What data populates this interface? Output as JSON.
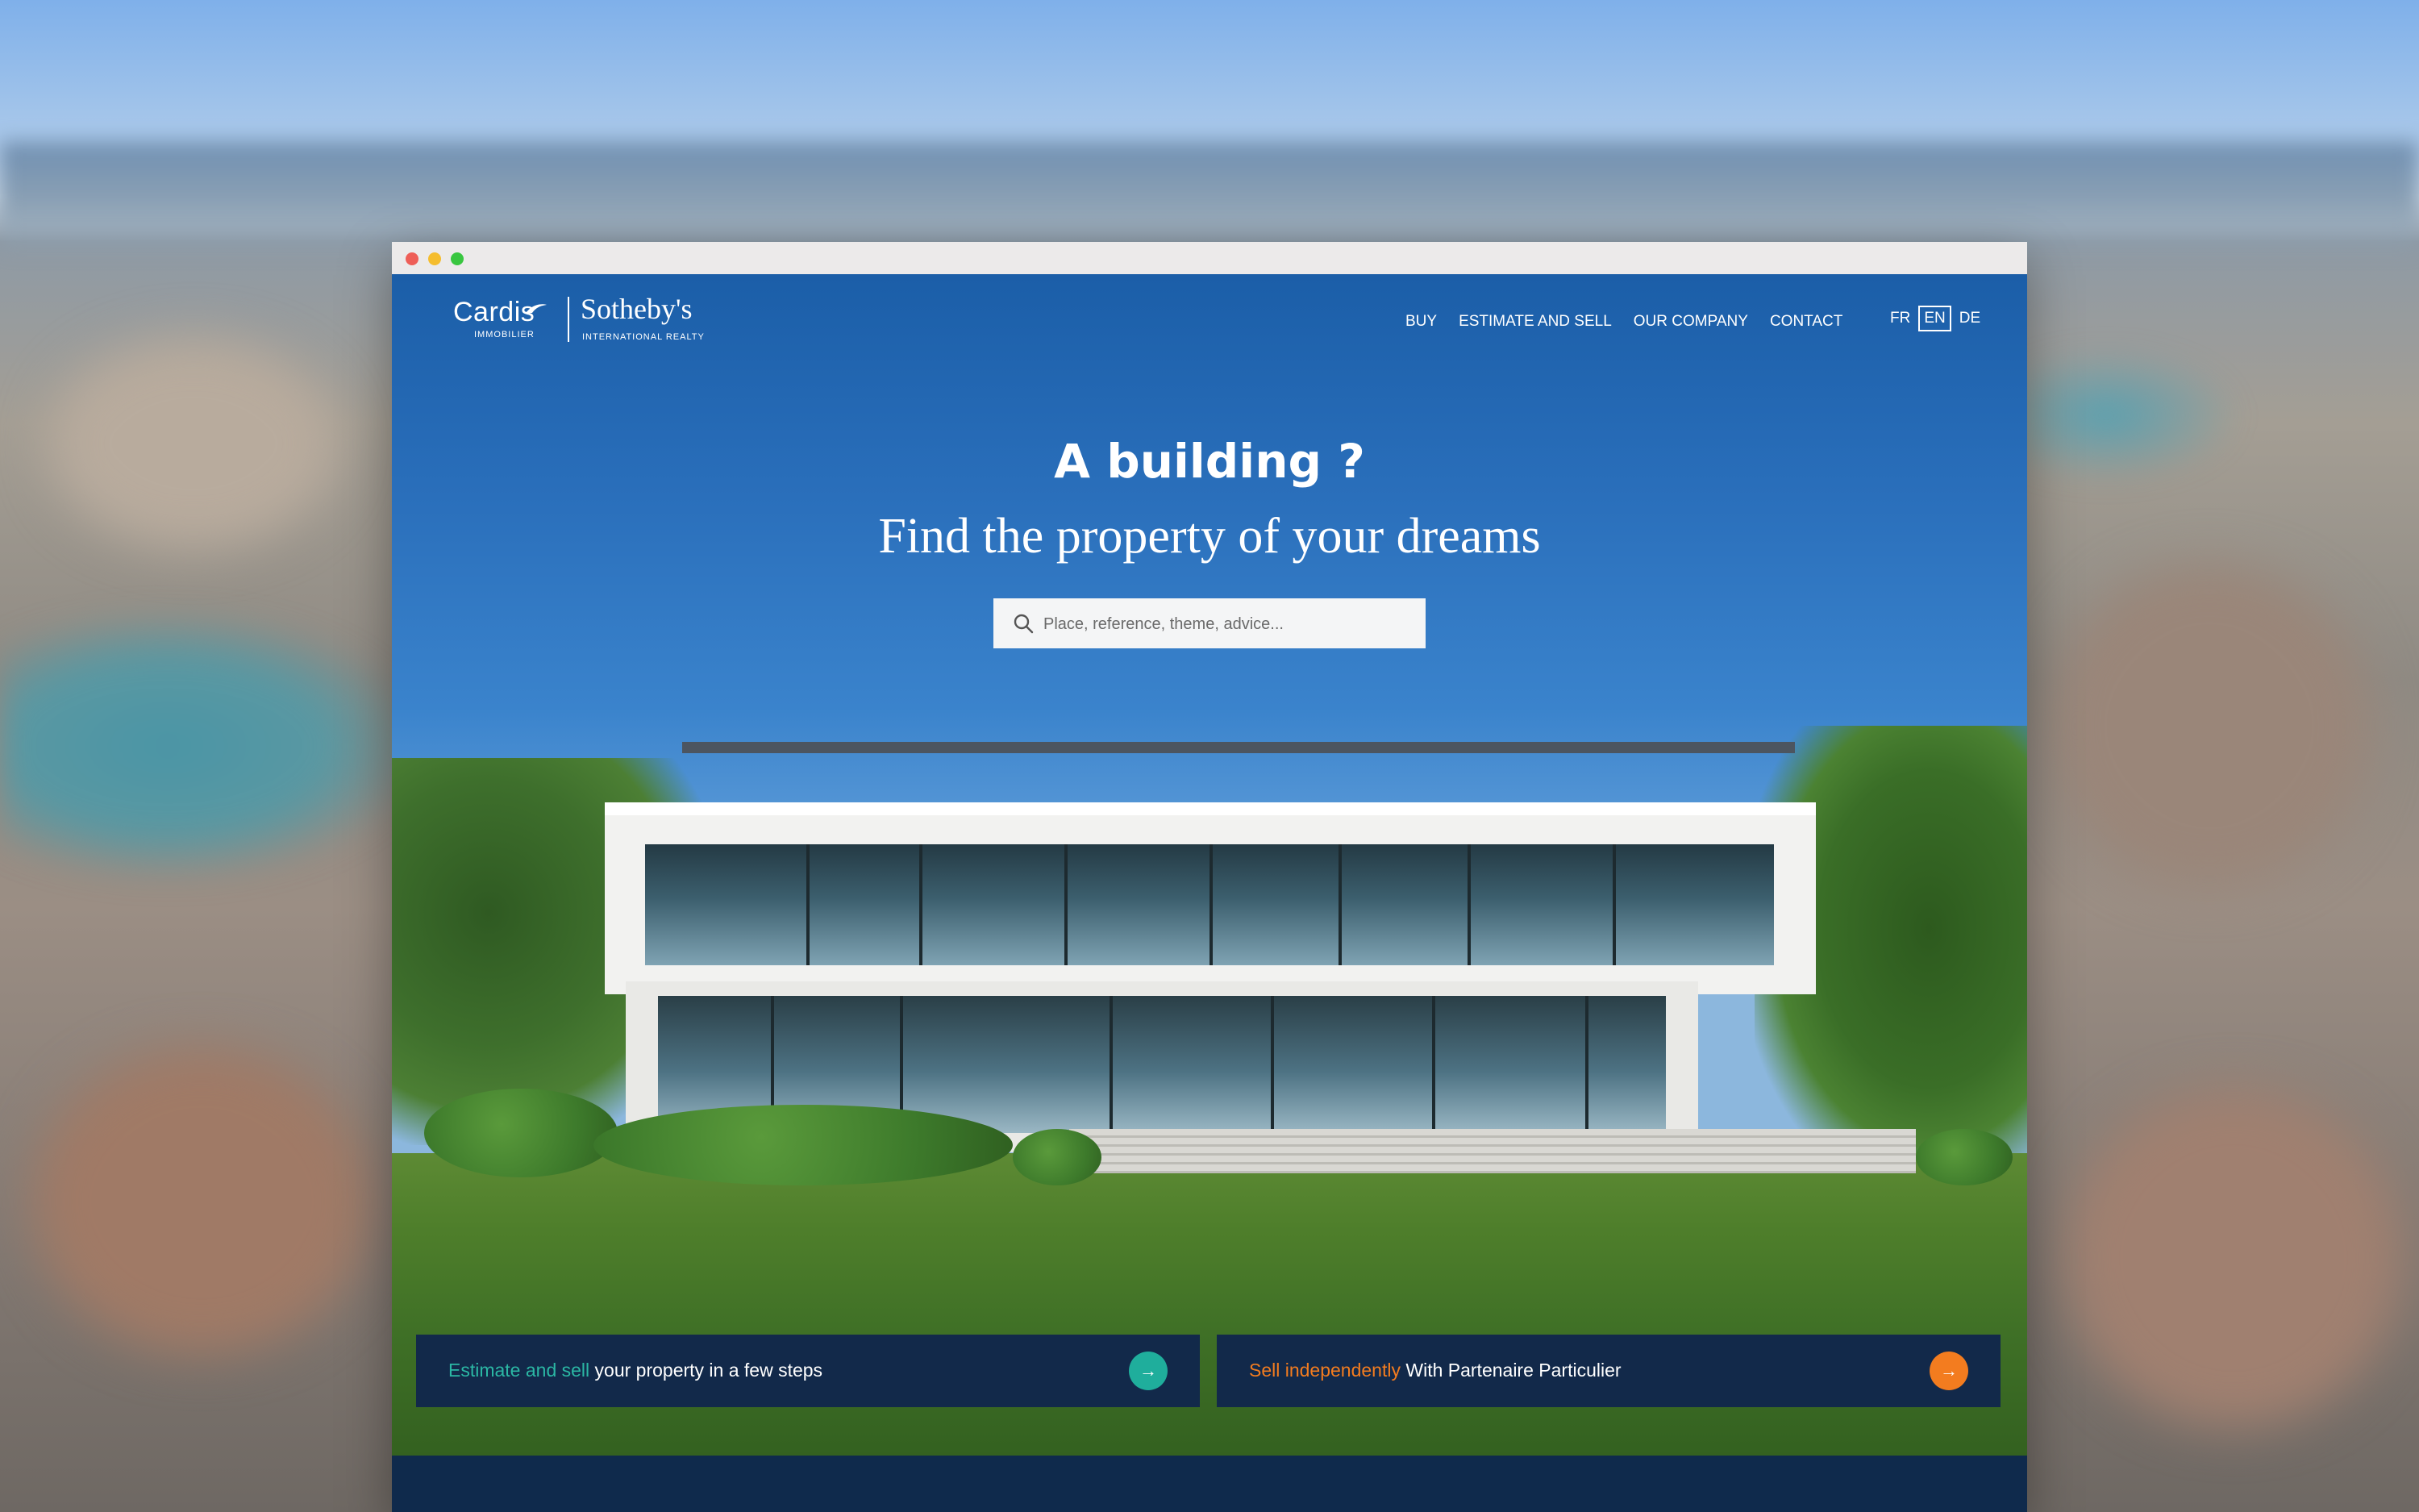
{
  "brand": {
    "cardis": "Cardis",
    "cardis_sub": "IMMOBILIER",
    "sothebys": "Sotheby's",
    "sothebys_sub": "INTERNATIONAL REALTY"
  },
  "nav": {
    "items": [
      {
        "label": "BUY"
      },
      {
        "label": "ESTIMATE AND SELL"
      },
      {
        "label": "OUR COMPANY"
      },
      {
        "label": "CONTACT"
      }
    ]
  },
  "languages": {
    "items": [
      "FR",
      "EN",
      "DE"
    ],
    "active": "EN"
  },
  "hero": {
    "title": "A building ?",
    "subtitle": "Find the property of your dreams"
  },
  "search": {
    "placeholder": "Place, reference, theme, advice..."
  },
  "cta": {
    "left": {
      "accent": "Estimate and sell",
      "text": " your property in a few steps"
    },
    "right": {
      "accent": "Sell independently",
      "text": " With Partenaire Particulier"
    }
  },
  "icons": {
    "search": "search-icon",
    "arrow": "arrow-right-icon"
  },
  "colors": {
    "header_blue": "#1b5ea8",
    "navy": "#12294a",
    "teal": "#1fae9c",
    "orange": "#f37c1f"
  }
}
